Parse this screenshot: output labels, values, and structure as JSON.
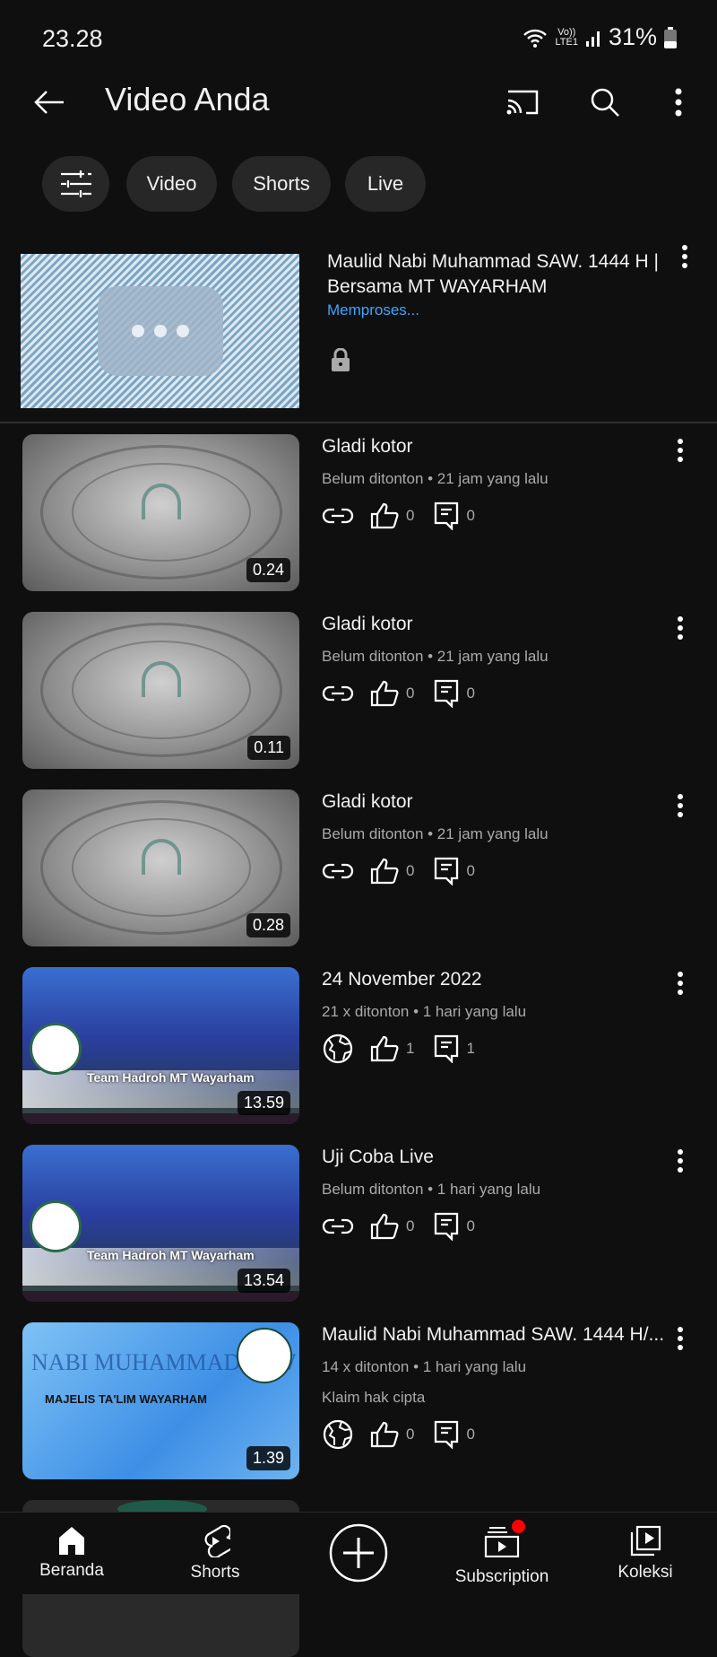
{
  "status_bar": {
    "time": "23.28",
    "network_top": "Vo))",
    "network_bottom": "LTE1",
    "battery": "31%"
  },
  "appbar": {
    "title": "Video Anda",
    "icons": [
      "back-arrow-icon",
      "cast-icon",
      "search-icon",
      "more-vert-icon"
    ]
  },
  "chips": [
    {
      "icon": "filter-icon"
    },
    {
      "label": "Video"
    },
    {
      "label": "Shorts"
    },
    {
      "label": "Live"
    }
  ],
  "processing": {
    "title_line1": "Maulid Nabi Muhammad SAW. 1444 H |",
    "title_line2": "Bersama MT WAYARHAM",
    "status": "Memproses...",
    "visibility_icon": "lock-icon",
    "status_color": "#3ea6ff"
  },
  "videos": [
    {
      "title": "Gladi kotor",
      "meta": "Belum ditonton • 21 jam yang lalu",
      "duration": "0.24",
      "visibility": "link-icon",
      "likes": "0",
      "comments": "0"
    },
    {
      "title": "Gladi kotor",
      "meta": "Belum ditonton • 21 jam yang lalu",
      "duration": "0.11",
      "visibility": "link-icon",
      "likes": "0",
      "comments": "0"
    },
    {
      "title": "Gladi kotor",
      "meta": "Belum ditonton • 21 jam yang lalu",
      "duration": "0.28",
      "visibility": "link-icon",
      "likes": "0",
      "comments": "0"
    },
    {
      "title": "24 November 2022",
      "meta": "21 x ditonton • 1 hari yang lalu",
      "duration": "13.59",
      "visibility": "globe-icon",
      "likes": "1",
      "comments": "1"
    },
    {
      "title": "Uji Coba Live",
      "meta": "Belum ditonton • 1 hari yang lalu",
      "duration": "13.54",
      "visibility": "link-icon",
      "likes": "0",
      "comments": "0"
    },
    {
      "title": "Maulid Nabi Muhammad SAW. 1444 H/...",
      "meta": "14 x ditonton • 1 hari yang lalu",
      "extra": "Klaim hak cipta",
      "duration": "1.39",
      "visibility": "globe-icon",
      "likes": "0",
      "comments": "0"
    }
  ],
  "thumb_text": {
    "banner": "Team Hadroh MT Wayarham",
    "poster_title": "NABI MUHAMMAD SAW",
    "poster_sub": "MAJELIS TA'LIM WAYARHAM"
  },
  "bottom_nav": [
    {
      "label": "Beranda",
      "icon": "home-icon"
    },
    {
      "label": "Shorts",
      "icon": "shorts-icon"
    },
    {
      "label": "",
      "icon": "create-icon"
    },
    {
      "label": "Subscription",
      "icon": "subscriptions-icon",
      "badge": true
    },
    {
      "label": "Koleksi",
      "icon": "library-icon"
    }
  ],
  "colors": {
    "background": "#0f0f0f",
    "chip": "#272727",
    "badge": "#ff0000"
  }
}
